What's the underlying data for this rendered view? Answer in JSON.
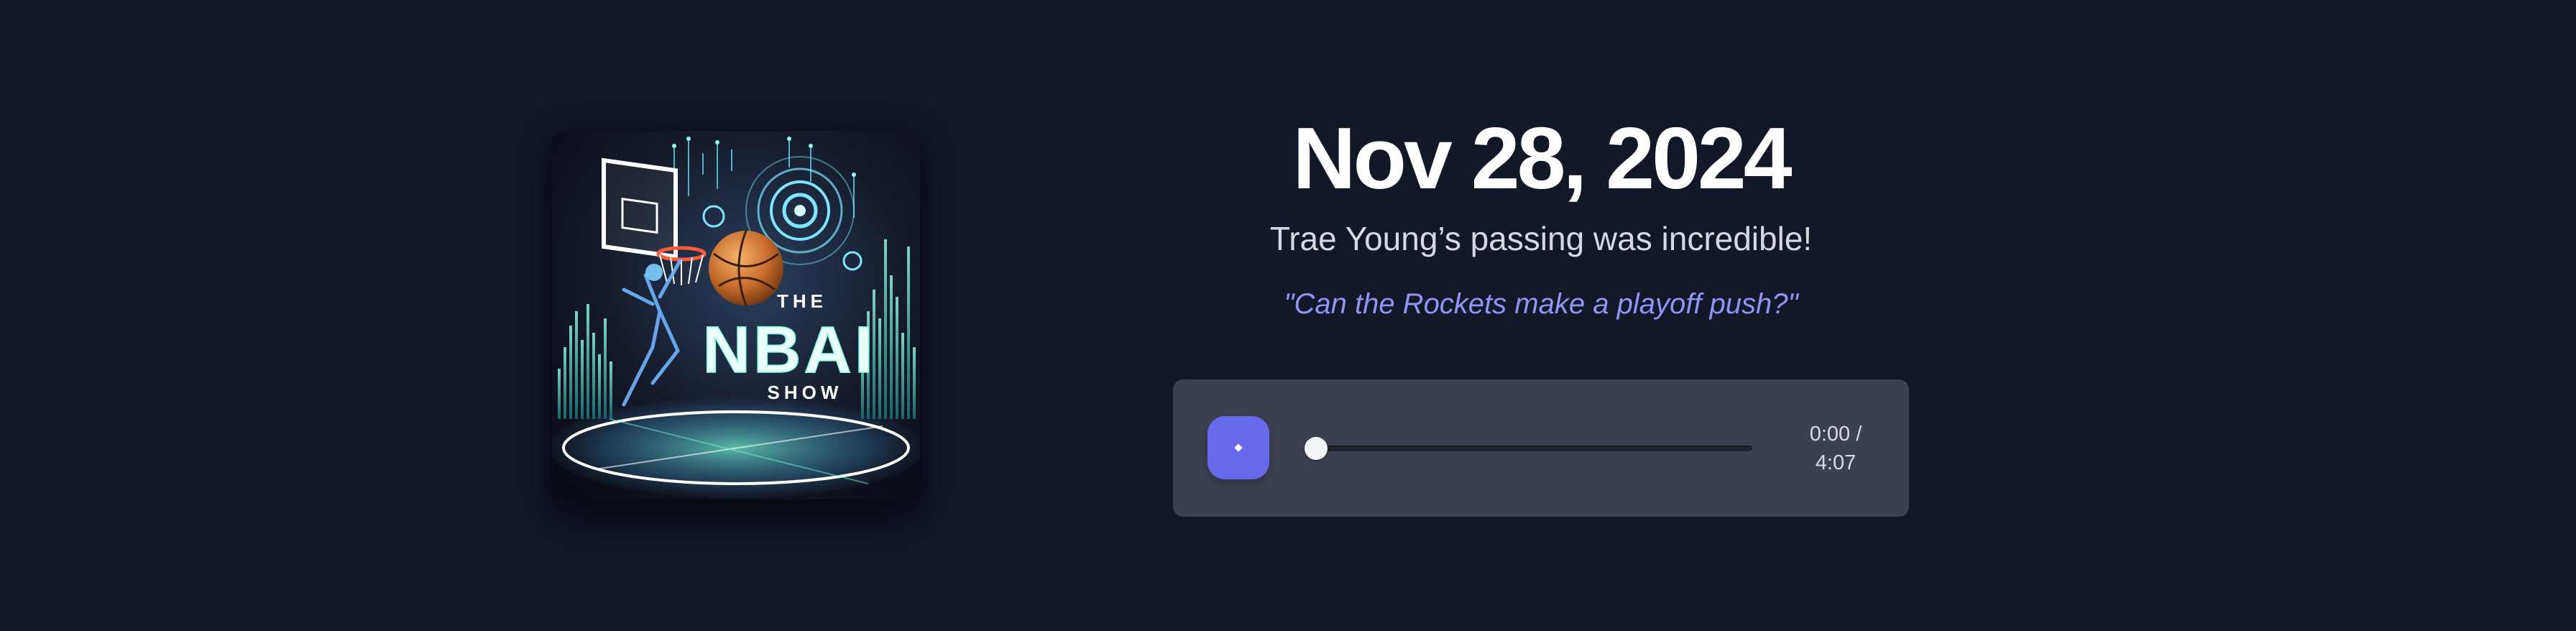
{
  "episode": {
    "date": "Nov 28, 2024",
    "headline": "Trae Young’s passing was incredible!",
    "question": "\"Can the Rockets make a playoff push?\""
  },
  "cover": {
    "line1": "THE",
    "line2": "NBAI",
    "line3": "SHOW"
  },
  "player": {
    "current_time": "0:00 /",
    "duration": "4:07",
    "progress": 0,
    "play_icon": "play-icon"
  },
  "colors": {
    "background": "#121828",
    "player_bg": "#3c4152",
    "accent": "#6569ea",
    "question_text": "#8f95f4"
  }
}
